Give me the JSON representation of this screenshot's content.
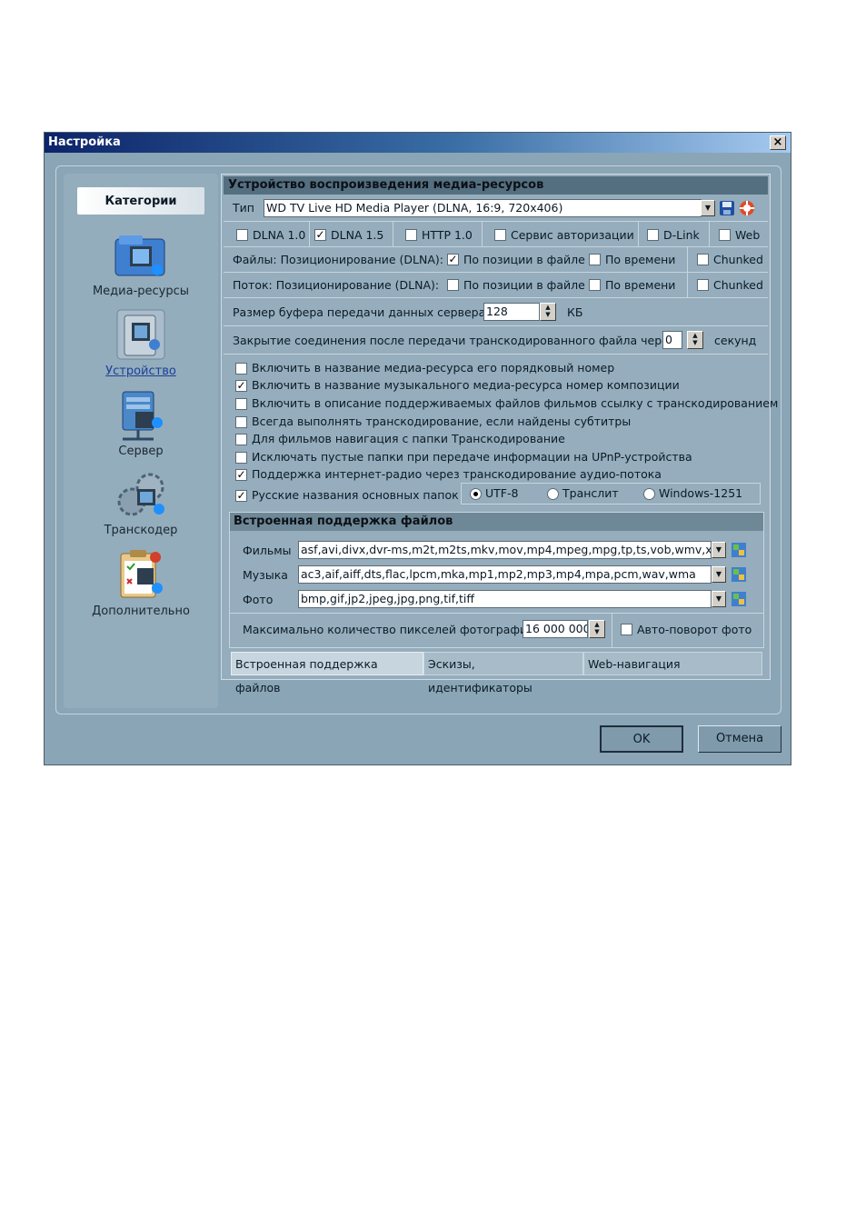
{
  "window": {
    "title": "Настройка",
    "close_label": "×"
  },
  "sidebar": {
    "header": "Категории",
    "items": [
      {
        "label": "Медиа-ресурсы",
        "icon": "media-resources-icon"
      },
      {
        "label": "Устройство",
        "icon": "device-icon"
      },
      {
        "label": "Сервер",
        "icon": "server-icon"
      },
      {
        "label": "Транскодер",
        "icon": "transcoder-icon"
      },
      {
        "label": "Дополнительно",
        "icon": "additional-icon"
      }
    ]
  },
  "device": {
    "section_title": "Устройство воспроизведения медиа-ресурсов",
    "type_label": "Тип",
    "type_value": "WD TV Live HD Media Player (DLNA, 16:9, 720x406)",
    "protocols": [
      {
        "label": "DLNA 1.0",
        "checked": false
      },
      {
        "label": "DLNA 1.5",
        "checked": true
      },
      {
        "label": "HTTP 1.0",
        "checked": false
      },
      {
        "label": "Сервис авторизации",
        "checked": false
      },
      {
        "label": "D-Link",
        "checked": false
      },
      {
        "label": "Web",
        "checked": false
      }
    ],
    "files_positioning": {
      "label": "Файлы: Позиционирование (DLNA):",
      "by_position": {
        "label": "По позиции в файле",
        "checked": true
      },
      "by_time": {
        "label": "По времени",
        "checked": false
      },
      "chunked": {
        "label": "Chunked",
        "checked": false
      }
    },
    "stream_positioning": {
      "label": "Поток: Позиционирование (DLNA):",
      "by_position": {
        "label": "По позиции в файле",
        "checked": false
      },
      "by_time": {
        "label": "По времени",
        "checked": false
      },
      "chunked": {
        "label": "Chunked",
        "checked": false
      }
    },
    "buffer": {
      "label": "Размер буфера передачи данных сервера",
      "value": "128",
      "unit": "КБ"
    },
    "close_conn": {
      "label": "Закрытие соединения после передачи транскодированного файла через",
      "value": "0",
      "unit": "секунд"
    },
    "options": [
      {
        "label": "Включить в название медиа-ресурса его порядковый номер",
        "checked": false
      },
      {
        "label": "Включить в название музыкального медиа-ресурса номер композиции",
        "checked": true
      },
      {
        "label": "Включить в описание поддерживаемых файлов фильмов ссылку с транскодированием",
        "checked": false
      },
      {
        "label": "Всегда выполнять транскодирование, если найдены субтитры",
        "checked": false
      },
      {
        "label": "Для фильмов навигация с папки Транскодирование",
        "checked": false
      },
      {
        "label": "Исключать пустые папки при передаче информации на  UPnP-устройства",
        "checked": false
      },
      {
        "label": "Поддержка интернет-радио через транскодирование аудио-потока",
        "checked": true
      }
    ],
    "russian_names": {
      "label": "Русские названия основных папок",
      "checked": true
    },
    "encoding": [
      {
        "label": "UTF-8",
        "selected": true
      },
      {
        "label": "Транслит",
        "selected": false
      },
      {
        "label": "Windows-1251",
        "selected": false
      }
    ],
    "builtin": {
      "title": "Встроенная поддержка файлов",
      "movies_label": "Фильмы",
      "movies_value": "asf,avi,divx,dvr-ms,m2t,m2ts,mkv,mov,mp4,mpeg,mpg,tp,ts,vob,wmv,xvid",
      "music_label": "Музыка",
      "music_value": "ac3,aif,aiff,dts,flac,lpcm,mka,mp1,mp2,mp3,mp4,mpa,pcm,wav,wma",
      "photo_label": "Фото",
      "photo_value": "bmp,gif,jp2,jpeg,jpg,png,tif,tiff",
      "max_pixels_label": "Максимально количество пикселей фотографий",
      "max_pixels_value": "16 000 000",
      "autorotate": {
        "label": "Авто-поворот фото",
        "checked": false
      }
    },
    "tabs": [
      "Встроенная поддержка файлов",
      "Эскизы, идентификаторы",
      "Web-навигация"
    ]
  },
  "buttons": {
    "ok": "OK",
    "cancel": "Отмена"
  },
  "check_glyph": "✓"
}
